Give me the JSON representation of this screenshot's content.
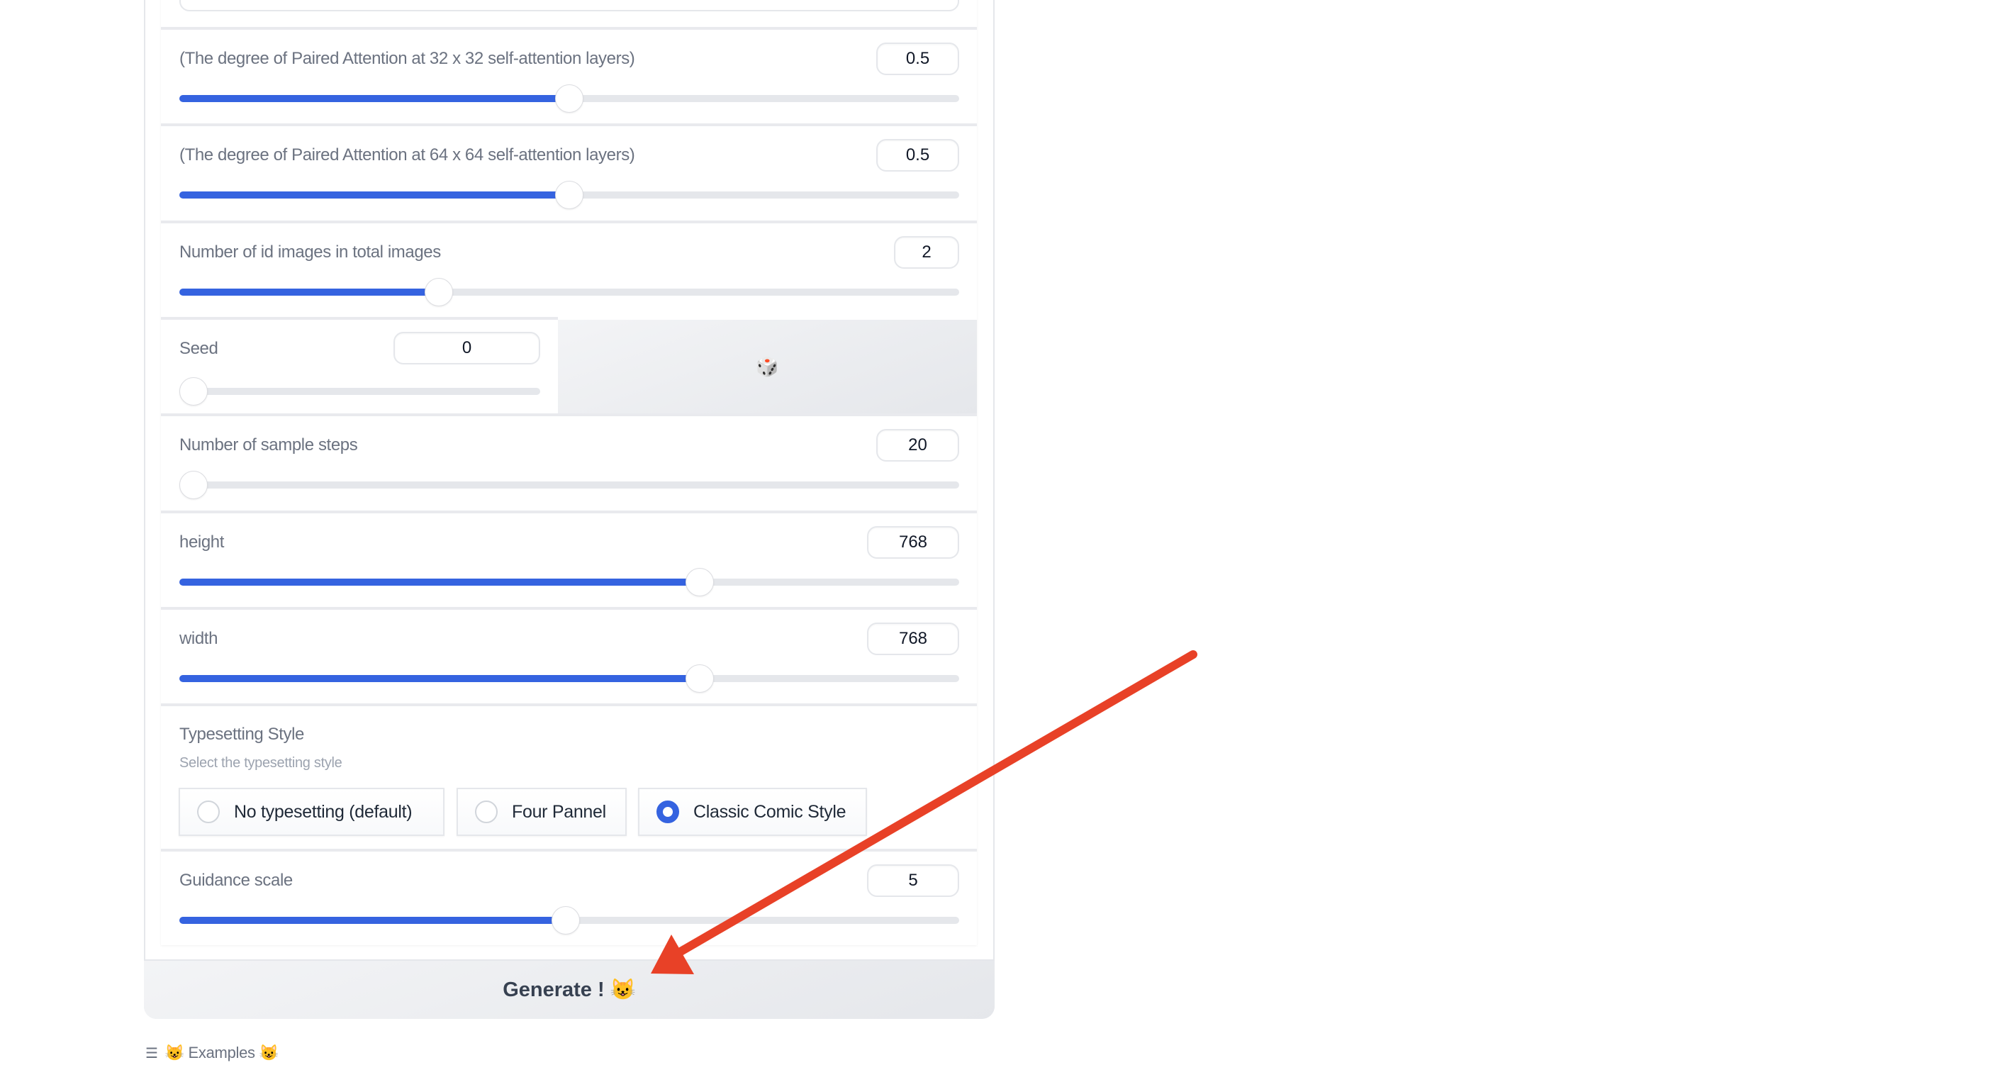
{
  "form": {
    "sliders": [
      {
        "label": "(The degree of Paired Attention at 32 x 32 self-attention layers)",
        "value": "0.5",
        "fraction": 0.5
      },
      {
        "label": "(The degree of Paired Attention at 64 x 64 self-attention layers)",
        "value": "0.5",
        "fraction": 0.5
      },
      {
        "label": "Number of id images in total images",
        "value": "2",
        "fraction": 0.333
      }
    ],
    "seed": {
      "label": "Seed",
      "value": "0",
      "fraction": 0.0,
      "randomize_icon": "🎲"
    },
    "steps": {
      "label": "Number of sample steps",
      "value": "20",
      "fraction": 0.0
    },
    "height": {
      "label": "height",
      "value": "768",
      "fraction": 0.667
    },
    "width": {
      "label": "width",
      "value": "768",
      "fraction": 0.667
    },
    "typesetting": {
      "label": "Typesetting Style",
      "info": "Select the typesetting style",
      "options": [
        {
          "label": "No typesetting (default)",
          "checked": false
        },
        {
          "label": "Four Pannel",
          "checked": false
        },
        {
          "label": "Classic Comic Style",
          "checked": true
        }
      ]
    },
    "guidance": {
      "label": "Guidance scale",
      "value": "5",
      "fraction": 0.495
    }
  },
  "generate_button": {
    "label": "Generate ! 😺"
  },
  "examples": {
    "icon": "☰",
    "label": "😺 Examples 😺"
  },
  "annotation": {
    "type": "arrow",
    "color": "#e84127",
    "points_to": "generate_button"
  },
  "colors": {
    "accent": "#3563e0",
    "track": "#e5e7eb",
    "arrow": "#e84127"
  }
}
